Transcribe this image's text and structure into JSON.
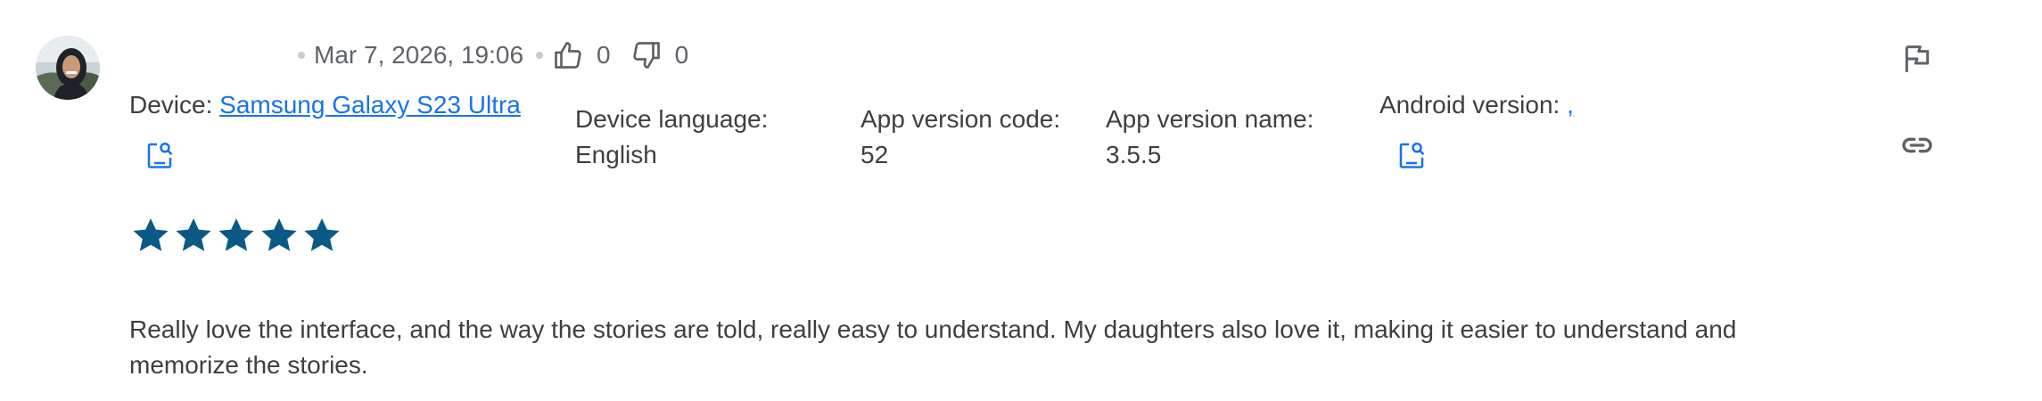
{
  "review": {
    "date": "Mar 7, 2026, 19:06",
    "upvotes": "0",
    "downvotes": "0",
    "device_label": "Device:",
    "device_name": "Samsung Galaxy S23 Ultra",
    "device_language_label": "Device language:",
    "device_language": "English",
    "app_version_code_label": "App version code:",
    "app_version_code": "52",
    "app_version_name_label": "App version name:",
    "app_version_name": "3.5.5",
    "android_version_label": "Android version:",
    "android_version": ",",
    "rating": 5,
    "rating_max": 5,
    "text": "Really love the interface, and the way the stories are told, really easy to understand. My daughters also love it, making it easier to understand and memorize the stories."
  },
  "colors": {
    "star": "#0b5a85",
    "link": "#1a73e8",
    "text": "#3c4043",
    "muted": "#5f6368"
  },
  "icons": {
    "thumbs_up": "thumb-up-icon",
    "thumbs_down": "thumb-down-icon",
    "lookup": "device-lookup-icon",
    "flag": "flag-icon",
    "link": "link-icon"
  }
}
